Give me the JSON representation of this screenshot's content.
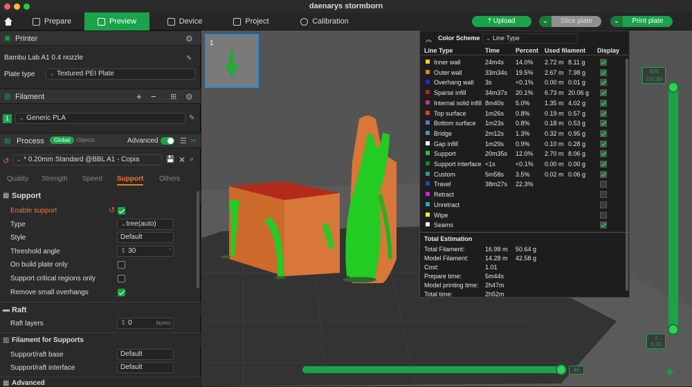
{
  "window": {
    "title": "daenarys stormborn"
  },
  "tabs": {
    "prepare": "Prepare",
    "preview": "Preview",
    "device": "Device",
    "project": "Project",
    "calibration": "Calibration"
  },
  "toolbar": {
    "upload": "Upload",
    "slice_plate": "Slice plate",
    "print_plate": "Print plate"
  },
  "printer": {
    "header": "Printer",
    "name": "Bambu Lab A1 0.4 nozzle",
    "plate_type_label": "Plate type",
    "plate_type_value": "Textured PEI Plate"
  },
  "filament": {
    "header": "Filament",
    "slot": "1",
    "name": "Generic PLA"
  },
  "process": {
    "header": "Process",
    "global": "Global",
    "objects": "Objects",
    "advanced_label": "Advanced",
    "preset": "* 0.20mm Standard @BBL A1 - Copia"
  },
  "process_tabs": {
    "quality": "Quality",
    "strength": "Strength",
    "speed": "Speed",
    "support": "Support",
    "others": "Others"
  },
  "support": {
    "header": "Support",
    "enable_label": "Enable support",
    "enable_checked": true,
    "type_label": "Type",
    "type_value": "tree(auto)",
    "style_label": "Style",
    "style_value": "Default",
    "threshold_label": "Threshold angle",
    "threshold_value": "30",
    "threshold_unit": "°",
    "build_plate_only_label": "On build plate only",
    "build_plate_only_checked": false,
    "critical_label": "Support critical regions only",
    "critical_checked": false,
    "remove_small_label": "Remove small overhangs",
    "remove_small_checked": true
  },
  "raft": {
    "header": "Raft",
    "layers_label": "Raft layers",
    "layers_value": "0",
    "layers_unit": "layers"
  },
  "filament_supports": {
    "header": "Filament for Supports",
    "base_label": "Support/raft base",
    "base_value": "Default",
    "interface_label": "Support/raft interface",
    "interface_value": "Default"
  },
  "advanced_section": {
    "header": "Advanced"
  },
  "plate_thumb": {
    "number": "1"
  },
  "color_scheme": {
    "title": "Color Scheme",
    "mode": "Line Type",
    "columns": [
      "Line Type",
      "Time",
      "Percent",
      "Used filament",
      "Display"
    ],
    "rows": [
      {
        "name": "Inner wall",
        "time": "24m4s",
        "percent": "14.0%",
        "length": "2.72 m",
        "weight": "8.11 g",
        "color": "#f5d218",
        "display": true
      },
      {
        "name": "Outer wall",
        "time": "33m34s",
        "percent": "19.5%",
        "length": "2.67 m",
        "weight": "7.98 g",
        "color": "#f47a13",
        "display": true
      },
      {
        "name": "Overhang wall",
        "time": "3s",
        "percent": "<0.1%",
        "length": "0.00 m",
        "weight": "0.01 g",
        "color": "#1d2bd8",
        "display": true
      },
      {
        "name": "Sparse infill",
        "time": "34m37s",
        "percent": "20.1%",
        "length": "6.73 m",
        "weight": "20.06 g",
        "color": "#b32121",
        "display": true
      },
      {
        "name": "Internal solid infill",
        "time": "8m40s",
        "percent": "5.0%",
        "length": "1.35 m",
        "weight": "4.02 g",
        "color": "#b8348b",
        "display": true
      },
      {
        "name": "Top surface",
        "time": "1m26s",
        "percent": "0.8%",
        "length": "0.19 m",
        "weight": "0.57 g",
        "color": "#e83a3a",
        "display": true
      },
      {
        "name": "Bottom surface",
        "time": "1m23s",
        "percent": "0.8%",
        "length": "0.18 m",
        "weight": "0.53 g",
        "color": "#6b6bd6",
        "display": true
      },
      {
        "name": "Bridge",
        "time": "2m12s",
        "percent": "1.3%",
        "length": "0.32 m",
        "weight": "0.95 g",
        "color": "#4a8fc7",
        "display": true
      },
      {
        "name": "Gap infill",
        "time": "1m29s",
        "percent": "0.9%",
        "length": "0.10 m",
        "weight": "0.28 g",
        "color": "#ffffff",
        "display": true
      },
      {
        "name": "Support",
        "time": "20m35s",
        "percent": "12.0%",
        "length": "2.70 m",
        "weight": "8.06 g",
        "color": "#1fd11f",
        "display": true
      },
      {
        "name": "Support interface",
        "time": "<1s",
        "percent": "<0.1%",
        "length": "0.00 m",
        "weight": "0.00 g",
        "color": "#12872a",
        "display": true
      },
      {
        "name": "Custom",
        "time": "5m58s",
        "percent": "3.5%",
        "length": "0.02 m",
        "weight": "0.06 g",
        "color": "#27a07e",
        "display": true
      },
      {
        "name": "Travel",
        "time": "38m27s",
        "percent": "22.3%",
        "length": "",
        "weight": "",
        "color": "#2146c8",
        "display": false
      },
      {
        "name": "Retract",
        "time": "",
        "percent": "",
        "length": "",
        "weight": "",
        "color": "#d31fd3",
        "display": false
      },
      {
        "name": "Unretract",
        "time": "",
        "percent": "",
        "length": "",
        "weight": "",
        "color": "#2aa6c8",
        "display": false
      },
      {
        "name": "Wipe",
        "time": "",
        "percent": "",
        "length": "",
        "weight": "",
        "color": "#f3f31f",
        "display": false
      },
      {
        "name": "Seams",
        "time": "",
        "percent": "",
        "length": "",
        "weight": "",
        "color": "#f0f0f0",
        "display": true
      }
    ],
    "total_header": "Total Estimation",
    "totals": [
      {
        "label": "Total Filament:",
        "v1": "16.98 m",
        "v2": "50.64 g"
      },
      {
        "label": "Model Filament:",
        "v1": "14.28 m",
        "v2": "42.58 g"
      },
      {
        "label": "Cost:",
        "v1": "1.01",
        "v2": ""
      },
      {
        "label": "Prepare time:",
        "v1": "5m44s",
        "v2": ""
      },
      {
        "label": "Model printing time:",
        "v1": "2h47m",
        "v2": ""
      },
      {
        "label": "Total time:",
        "v1": "2h52m",
        "v2": ""
      }
    ]
  },
  "layer_slider": {
    "top_layer": "504",
    "top_height": "100.80",
    "bottom_layer": "1",
    "bottom_height": "0.20"
  },
  "move_slider": {
    "value": "46"
  },
  "colors": {
    "accent": "#1aa34a",
    "viewport": "#545454"
  }
}
